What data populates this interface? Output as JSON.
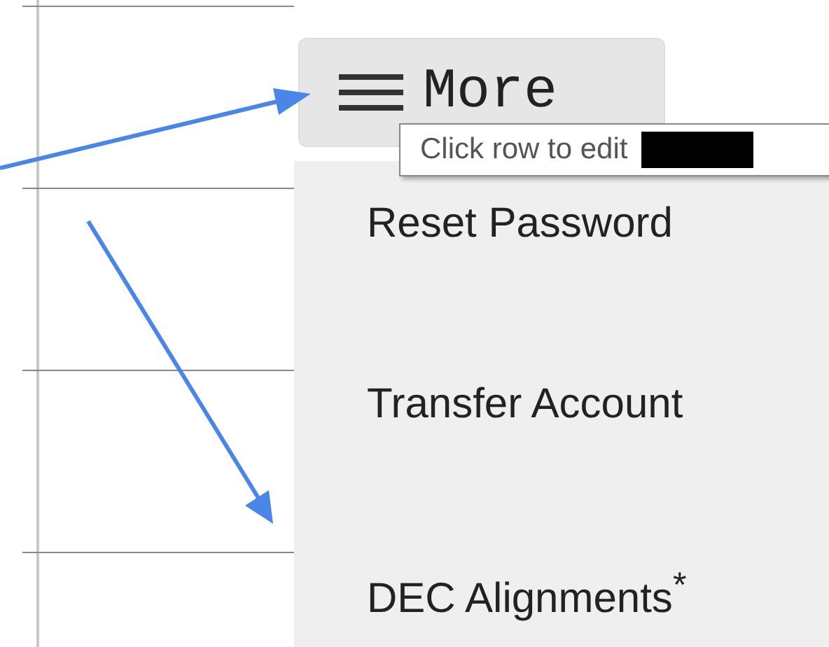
{
  "more_button": {
    "label": "More"
  },
  "tooltip": {
    "text": "Click row to edit"
  },
  "menu": {
    "items": [
      {
        "label": "Reset Password"
      },
      {
        "label": "Transfer Account"
      },
      {
        "label": "DEC Alignments$^{*}$"
      }
    ]
  }
}
